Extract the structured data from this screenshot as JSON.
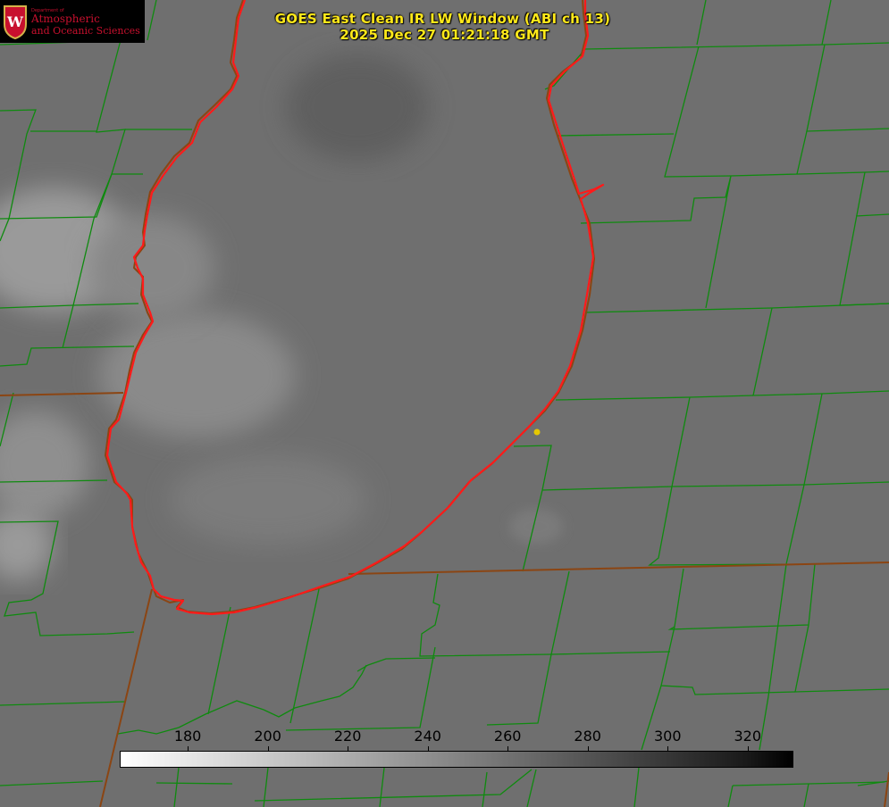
{
  "header": {
    "title_line1": "GOES East Clean IR LW Window (ABI ch 13)",
    "title_line2": "2025 Dec 27 01:21:18 GMT"
  },
  "logo": {
    "department": "Department of",
    "line1": "Atmospheric",
    "line2": "and Oceanic Sciences",
    "crest_letter": "W"
  },
  "colorbar": {
    "ticks": [
      "180",
      "200",
      "220",
      "240",
      "260",
      "280",
      "300",
      "320"
    ],
    "range_min": 163,
    "range_max": 331,
    "colormap": "white-to-black (warm = dark)"
  },
  "colors": {
    "title": "#ffe81a",
    "lake_outline": "#ff1a1a",
    "county_lines": "#0f8a0f",
    "state_lines": "#8b4513",
    "marker": "#e6c800",
    "logo_text": "#c8102e"
  },
  "map": {
    "feature": "lake-shoreline",
    "marker_icon": "city-dot-icon"
  }
}
